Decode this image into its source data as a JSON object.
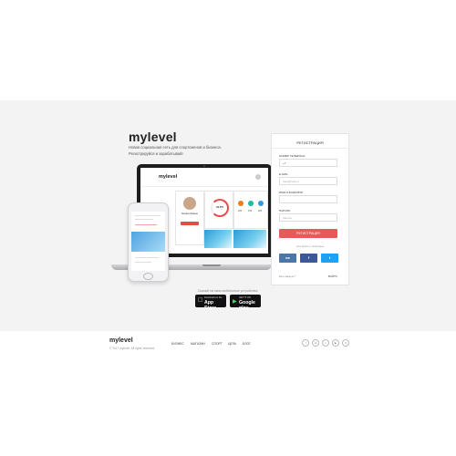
{
  "hero": {
    "brand": "mylevel",
    "tagline": "Новая социальная сеть для спортсменов и бизнеса.\nРегистрируйся и зарабатывай!",
    "mobile_note": "Скачай на свои мобильные устройства:"
  },
  "laptop_app": {
    "logo": "mylevel",
    "profile_name": "Михаил Иванов",
    "ring_value": "40 PV",
    "stats": [
      "200",
      "150",
      "180"
    ]
  },
  "registration": {
    "title": "РЕГИСТРАЦИЯ",
    "phone_label": "НОМЕР ТЕЛЕФОНА",
    "phone_value": "+7",
    "email_label": "E-MAIL",
    "email_placeholder": "user@mail.ru",
    "name_label": "ИМЯ И ФАМИЛИЯ",
    "name_placeholder": "",
    "password_label": "ПАРОЛЬ",
    "password_placeholder": "пароль",
    "submit": "РЕГИСТРАЦИЯ",
    "or_via": "или войти с помощью",
    "social": [
      {
        "label": "вк",
        "color": "#4a76a8"
      },
      {
        "label": "f",
        "color": "#3b5998"
      },
      {
        "label": "t",
        "color": "#1da1f2"
      }
    ],
    "has_account": "Есть аккаунт?",
    "login": "ВОЙТИ"
  },
  "stores": {
    "appstore_small": "Download on the",
    "appstore_big": "App Store",
    "google_small": "GET IT ON",
    "google_big": "Google play"
  },
  "footer": {
    "logo": "mylevel",
    "copyright": "© 2017 mylevel. All rights reserved.",
    "nav": [
      "БИЗНЕС",
      "МАГАЗИН",
      "СПОРТ",
      "ЦЕЛЬ",
      "БЛОГ"
    ],
    "social_icons": [
      "facebook-icon",
      "vk-icon",
      "twitter-icon",
      "youtube-icon",
      "instagram-icon"
    ],
    "social_glyphs": [
      "f",
      "vk",
      "t",
      "▶",
      "◎"
    ]
  }
}
